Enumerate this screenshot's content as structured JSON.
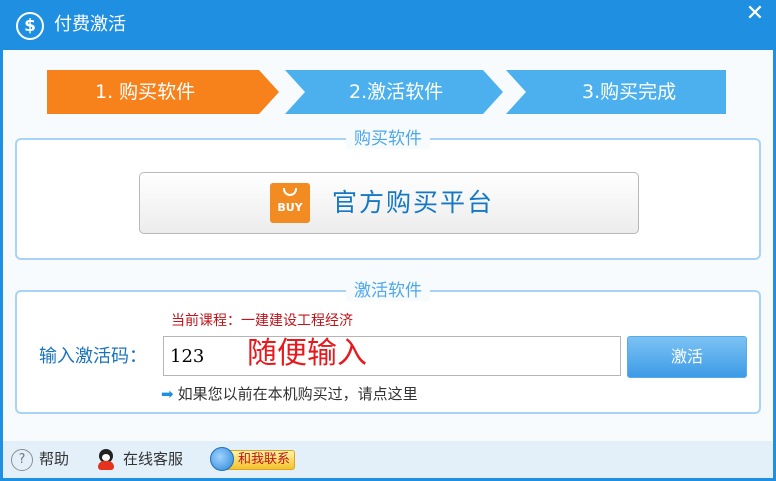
{
  "window": {
    "title": "付费激活",
    "title_icon": "dollar-icon",
    "close_glyph": "✕"
  },
  "steps": [
    {
      "label": "1. 购买软件",
      "active": true,
      "color": "#f7821b"
    },
    {
      "label": "2.激活软件",
      "active": false,
      "color": "#4cb0ee"
    },
    {
      "label": "3.购买完成",
      "active": false,
      "color": "#4cb0ee"
    }
  ],
  "purchase": {
    "section_title": "购买软件",
    "button_icon_text": "BUY",
    "button_label": "官方购买平台"
  },
  "activation": {
    "section_title": "激活软件",
    "course_text": "当前课程：一建建设工程经济",
    "code_label": "输入激活码：",
    "code_value": "123",
    "annotation": "随便输入",
    "activate_button": "激活",
    "hint_text": "如果您以前在本机购买过，请点这里"
  },
  "footer": {
    "help": "帮助",
    "support": "在线客服",
    "contact": "和我联系"
  },
  "colors": {
    "title_bar": "#1e8fe1",
    "step_active": "#f7821b",
    "step_inactive": "#4cb0ee",
    "annotation": "#e8191c",
    "course_text": "#c0151b"
  }
}
